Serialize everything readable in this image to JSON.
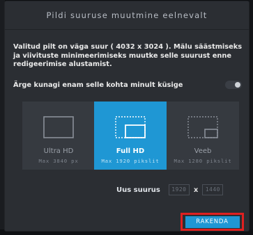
{
  "dialog": {
    "title": "Pildi suuruse muutmine eelnevalt",
    "message": "Valitud pilt on väga suur ( 4032 x 3024 ). Mälu säästmiseks ja viivituste minimeerimiseks muutke selle suurust enne redigeerimise alustamist.",
    "ask_label": "Ärge kunagi enam selle kohta minult küsige",
    "ask_toggle_on": false
  },
  "options": [
    {
      "name": "Ultra HD",
      "max": "Max 3840 px",
      "selected": false
    },
    {
      "name": "Full HD",
      "max": "Max 1920 pikslit",
      "selected": true
    },
    {
      "name": "Veeb",
      "max": "Max 1280 pikslit",
      "selected": false
    }
  ],
  "new_size": {
    "label": "Uus suurus",
    "width_placeholder": "1920",
    "separator": "x",
    "height_placeholder": "1440"
  },
  "apply_label": "RAKENDA",
  "colors": {
    "accent": "#1f97d4",
    "dialog_bg": "#2b2e33",
    "highlight": "#e02020"
  }
}
